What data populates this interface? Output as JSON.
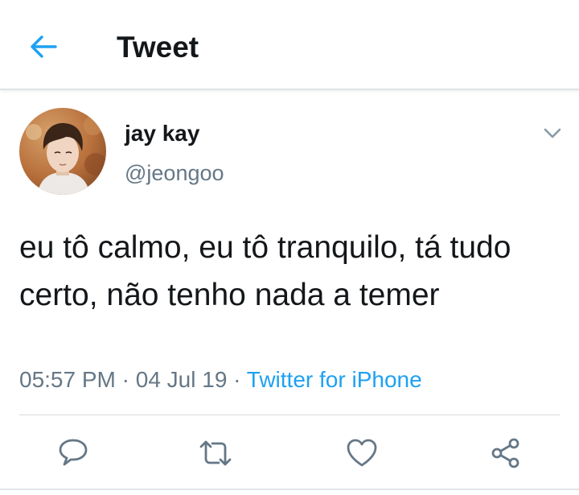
{
  "header": {
    "back_icon": "arrow-left-icon",
    "title": "Tweet",
    "accent_color": "#1da1f2"
  },
  "tweet": {
    "display_name": "jay kay",
    "handle": "@jeongoo",
    "text": "eu tô calmo, eu tô tranquilo, tá tudo certo, não tenho nada a temer",
    "time": "05:57 PM",
    "separator": "·",
    "date": "04 Jul 19",
    "source": "Twitter for iPhone",
    "menu_icon": "chevron-down-icon"
  },
  "actions": {
    "reply_icon": "reply-icon",
    "retweet_icon": "retweet-icon",
    "like_icon": "heart-icon",
    "share_icon": "share-icon"
  },
  "colors": {
    "text": "#14171a",
    "secondary": "#657786",
    "link": "#1da1f2"
  }
}
